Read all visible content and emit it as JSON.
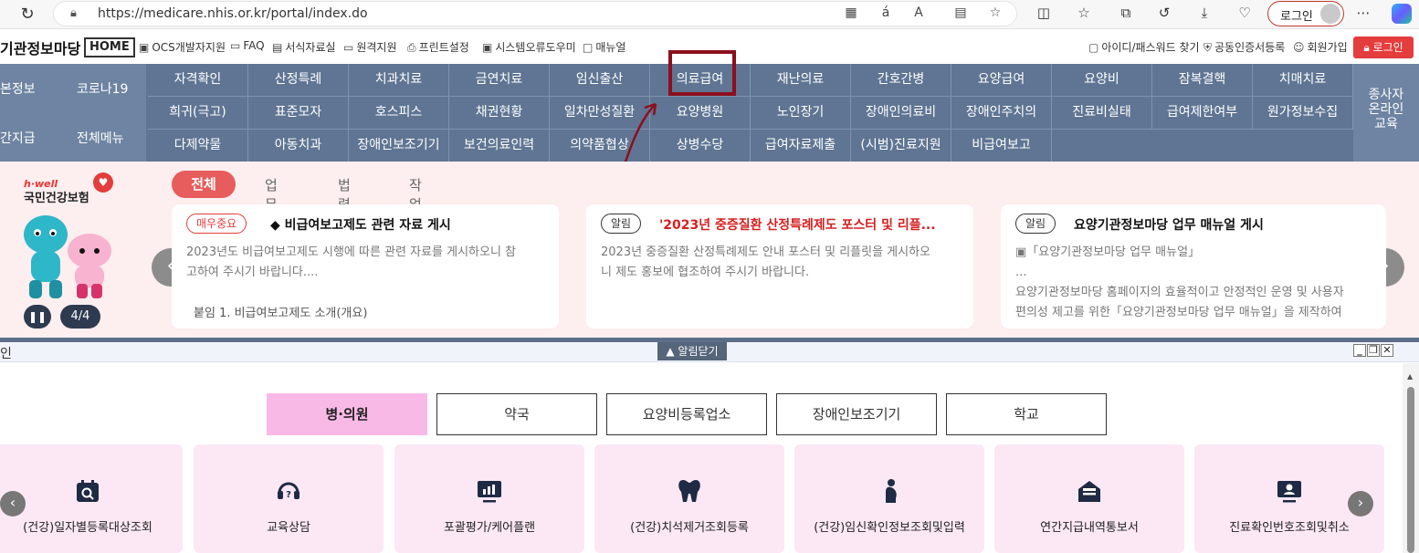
{
  "browser": {
    "url": "https://medicare.nhis.or.kr/portal/index.do",
    "login_label": "로그인"
  },
  "util": {
    "site_name": "기관정보마당",
    "home_label": "HOME",
    "links": [
      "OCS개발자지원",
      "FAQ",
      "서식자료실",
      "원격지원",
      "프린트설정",
      "시스템오류도우미",
      "매뉴얼"
    ],
    "right_links": [
      "아이디/패스워드 찾기",
      "공동인증서등록",
      "회원가입"
    ],
    "login_label": "로그인"
  },
  "nav": {
    "left": [
      "본정보",
      "코로나19",
      "간지급",
      "전체메뉴"
    ],
    "row1": [
      "자격확인",
      "산정특례",
      "치과치료",
      "금연치료",
      "임신출산",
      "의료급여",
      "재난의료",
      "간호간병",
      "요양급여",
      "요양비",
      "잠복결핵",
      "치매치료"
    ],
    "row2": [
      "희귀(극고)",
      "표준모자",
      "호스피스",
      "채권현황",
      "일차만성질환",
      "요양병원",
      "노인장기",
      "장애인의료비",
      "장애인주치의",
      "진료비실태",
      "급여제한여부",
      "원가정보수집"
    ],
    "row3": [
      "다제약물",
      "아동치과",
      "장애인보조기기",
      "보건의료인력",
      "의약품협상",
      "상병수당",
      "급여자료제출",
      "(시범)진료지원",
      "비급여보고"
    ],
    "right_label": "종사자 온라인 교육"
  },
  "notice": {
    "brand_hwell": "h·well",
    "brand_name": "국민건강보험",
    "page_indicator": "4/4",
    "tabs": [
      "전체",
      "업무",
      "법령",
      "작업"
    ],
    "cards": [
      {
        "badge": "매우중요",
        "title": "◆ 비급여보고제도 관련 자료 게시",
        "body1": "2023년도 비급여보고제도 시행에 따른 관련 자료를 게시하오니 참",
        "body2": "고하여 주시기 바랍니다....",
        "foot": "붙임 1. 비급여보고제도 소개(개요)"
      },
      {
        "badge": "알림",
        "title": "'2023년 중증질환 산정특례제도 포스터 및 리플...",
        "body1": "2023년 중증질환 산정특례제도 안내 포스터 및 리플릿을 게시하오",
        "body2": "니 제도 홍보에 협조하여 주시기 바랍니다."
      },
      {
        "badge": "알림",
        "title": "요양기관정보마당 업무 매뉴얼 게시",
        "body1": "▣「요양기관정보마당 업무 매뉴얼」",
        "body2": "...",
        "body3": "요양기관정보마당 홈페이지의 효율적이고 안정적인 운영 및 사용자",
        "body4": "편의성 제고를 위한「요양기관정보마당 업무 매뉴얼」을 제작하여"
      }
    ]
  },
  "panel": {
    "title": "인",
    "close_notice": "▲ 알림닫기",
    "categories": [
      "병·의원",
      "약국",
      "요양비등록업소",
      "장애인보조기기",
      "학교"
    ],
    "services": [
      "(건강)일자별등록대상조회",
      "교육상담",
      "포괄평가/케어플랜",
      "(건강)치석제거조회등록",
      "(건강)임신확인정보조회및입력",
      "연간지급내역통보서",
      "진료확인번호조회및취소"
    ]
  },
  "colors": {
    "nav_bg": "#5f7593",
    "accent_red": "#e43d3d",
    "highlight_box": "#8b0f1c",
    "category_active": "#f9b9e6",
    "service_card": "#fce8f5"
  }
}
